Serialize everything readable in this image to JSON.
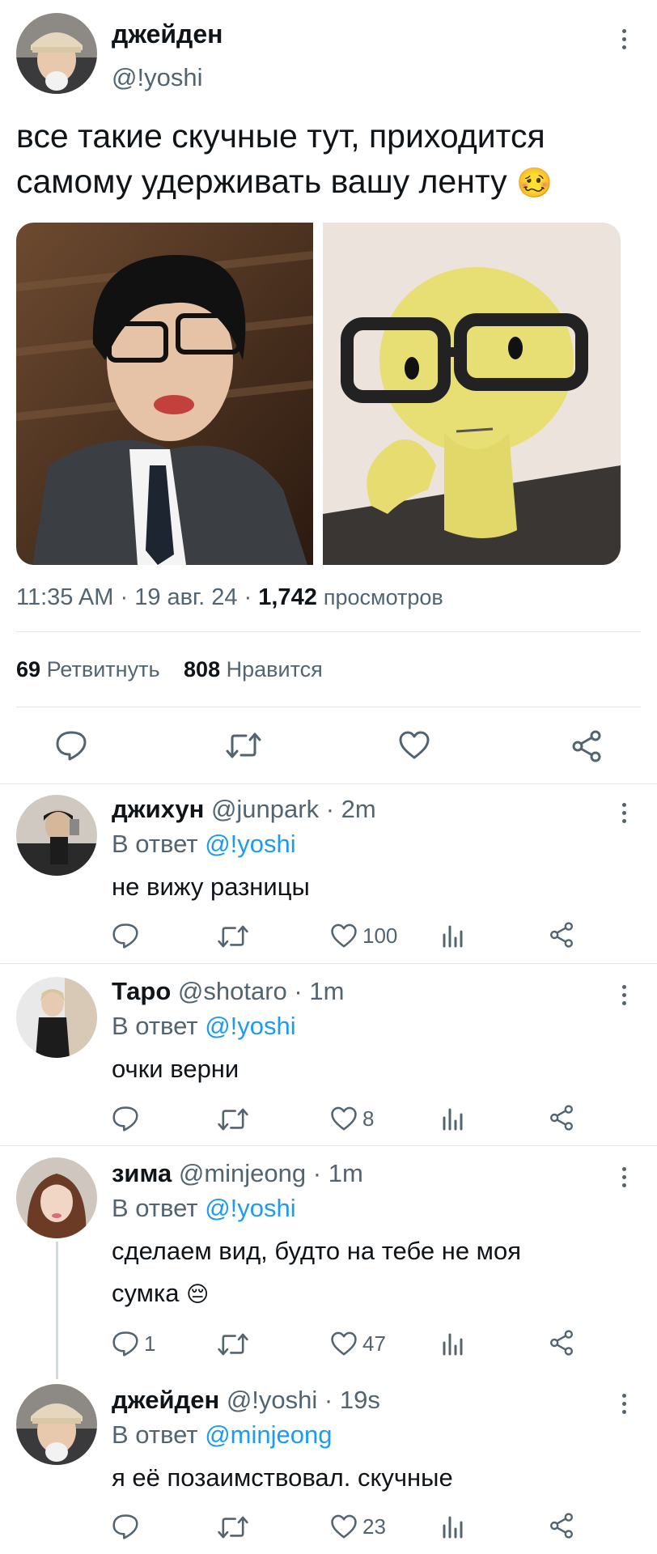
{
  "colors": {
    "accent": "#1d9bf0",
    "muted": "#536471",
    "text": "#0f1419",
    "divider": "#e1e6ea"
  },
  "main_tweet": {
    "display_name": "джейден",
    "handle": "@!yoshi",
    "text": "все такие скучные тут, приходится самому удерживать вашу ленту",
    "emoji": "🥴",
    "images": [
      "photo-person-glasses",
      "photo-yellow-figure-glasses"
    ],
    "time": "11:35 AM",
    "date": "19 авг. 24",
    "views_count": "1,742",
    "views_label": "просмотров",
    "retweets_count": "69",
    "retweets_label": "Ретвитнуть",
    "likes_count": "808",
    "likes_label": "Нравится",
    "actions": [
      "reply-icon",
      "retweet-icon",
      "like-icon",
      "share-icon"
    ]
  },
  "replies": [
    {
      "display_name": "джихун",
      "handle": "@junpark",
      "time": "2m",
      "reply_to_label": "В ответ",
      "reply_to": "@!yoshi",
      "text": "не вижу разницы",
      "reply_count": "",
      "retweet_count": "",
      "like_count": "100"
    },
    {
      "display_name": "Таро",
      "handle": "@shotaro",
      "time": "1m",
      "reply_to_label": "В ответ",
      "reply_to": "@!yoshi",
      "text": "очки верни",
      "reply_count": "",
      "retweet_count": "",
      "like_count": "8"
    },
    {
      "display_name": "зима",
      "handle": "@minjeong",
      "time": "1m",
      "reply_to_label": "В ответ",
      "reply_to": "@!yoshi",
      "text": "сделаем вид, будто на тебе не моя",
      "text2": "сумка",
      "emoji": "😔",
      "reply_count": "1",
      "retweet_count": "",
      "like_count": "47"
    },
    {
      "display_name": "джейден",
      "handle": "@!yoshi",
      "time": "19s",
      "reply_to_label": "В ответ",
      "reply_to": "@minjeong",
      "text": "я её позаимствовал. скучные",
      "reply_count": "",
      "retweet_count": "",
      "like_count": "23"
    }
  ],
  "separator": "·"
}
